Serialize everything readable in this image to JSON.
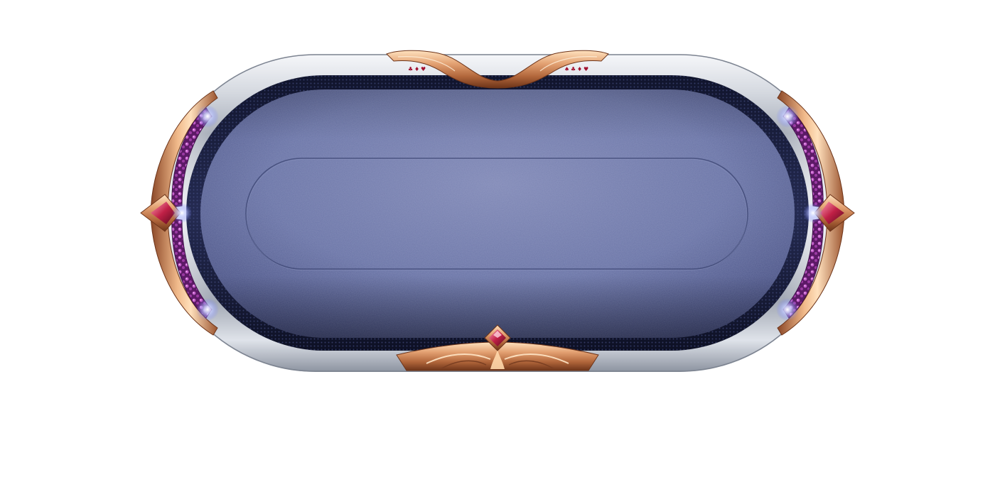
{
  "scene": {
    "background_color": "#ffffff",
    "object": "poker-table",
    "shape": "stadium (rounded oval)",
    "colors": {
      "felt_light": "#7d87b4",
      "felt_mid": "#5f6a9e",
      "felt_dark": "#333c6c",
      "mesh_rim": "#1c2140",
      "silver_light": "#f4f6fa",
      "silver_mid": "#c8cdd6",
      "silver_dark": "#8e95a2",
      "bronze_light": "#ffd9b0",
      "bronze_mid": "#d0875a",
      "bronze_dark": "#7a3f22",
      "gem_purple": "#8a2e8e",
      "gem_ruby": "#c02046",
      "glow": "#dfe3ff"
    },
    "decorations": {
      "top_left_suits": [
        "♣",
        "♦",
        "♥"
      ],
      "top_right_suits": [
        "♠",
        "♣",
        "♦",
        "♥"
      ],
      "icons": [
        "ruby-gem-icon",
        "suit-club-icon",
        "suit-diamond-icon",
        "suit-heart-icon",
        "suit-spade-icon"
      ]
    }
  }
}
